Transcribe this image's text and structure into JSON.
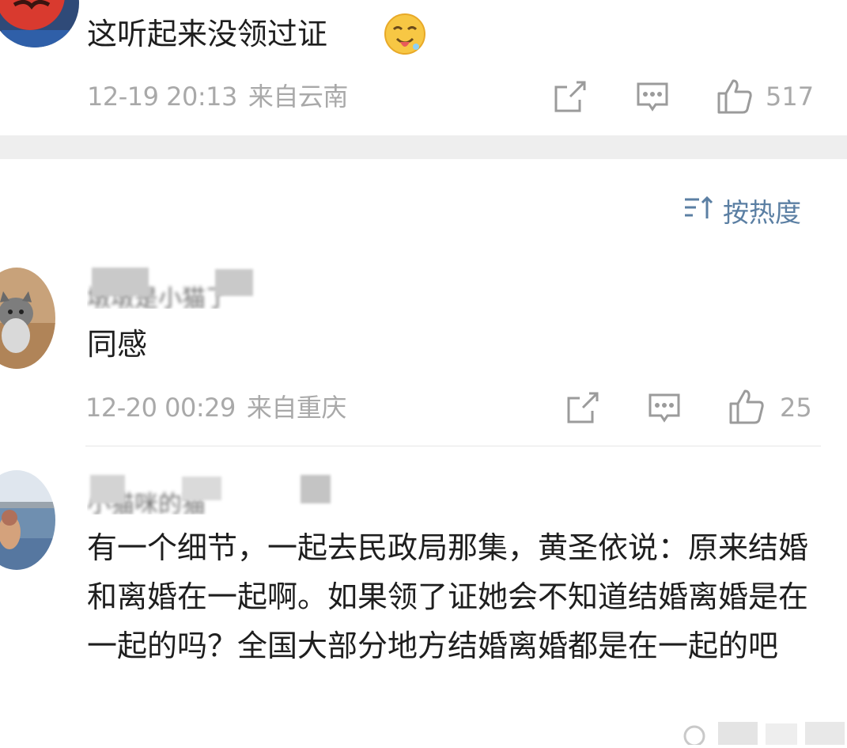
{
  "comments": [
    {
      "username": "",
      "text": "这听起来没领过证",
      "emoji_icon": "drooling-face-emoji-icon",
      "time": "12-19 20:13",
      "location": "来自云南",
      "likes": "517"
    },
    {
      "username": "墩墩是小猫了",
      "text": "同感",
      "time": "12-20 00:29",
      "location": "来自重庆",
      "likes": "25"
    },
    {
      "username": "小猫咪的猫",
      "text": "有一个细节，一起去民政局那集，黄圣依说：原来结婚和离婚在一起啊。如果领了证她会不知道结婚离婚是在一起的吗？全国大部分地方结婚离婚都是在一起的吧",
      "time": "",
      "location": "",
      "likes": ""
    }
  ],
  "sort": {
    "label": "按热度",
    "icon": "sort-descending-icon"
  },
  "colors": {
    "meta_gray": "#a9a9a9",
    "sort_blue": "#5b7fa3",
    "separator": "#eeeeee"
  }
}
